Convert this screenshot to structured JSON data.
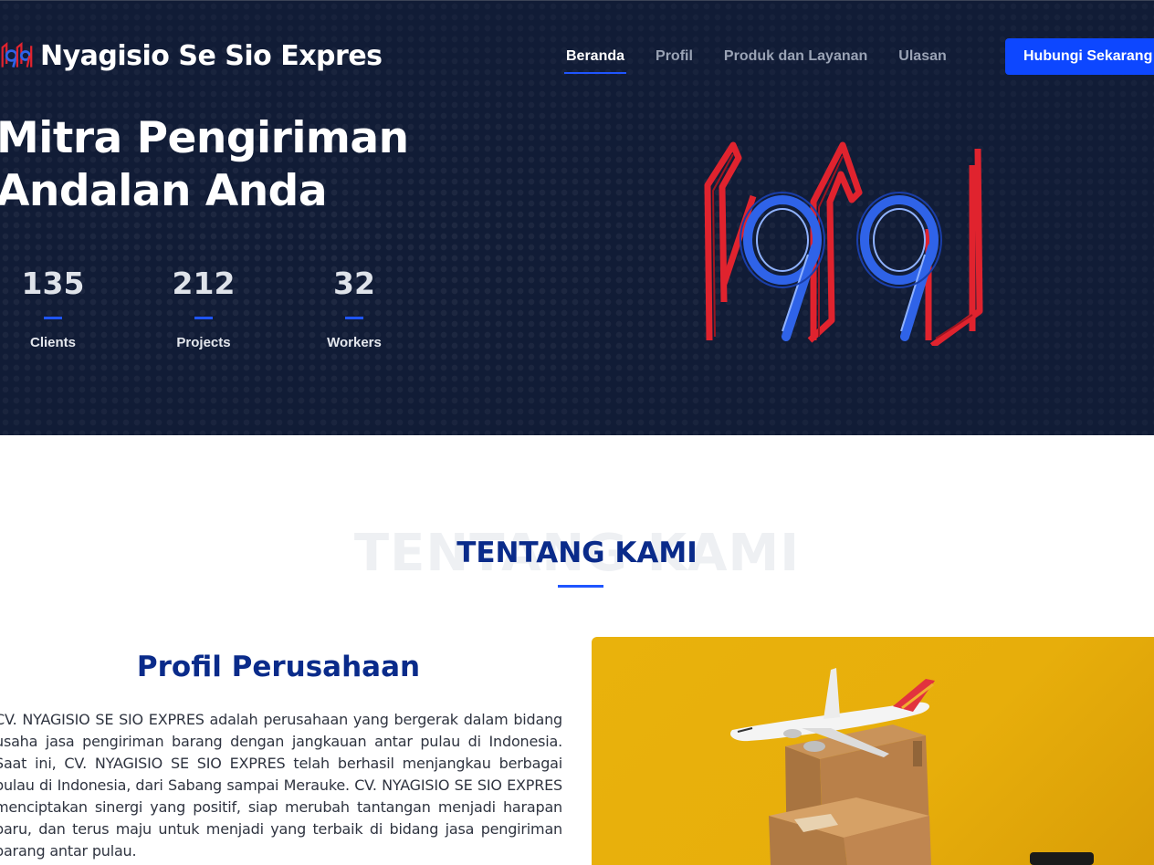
{
  "header": {
    "brand_name": "Nyagisio Se Sio Expres",
    "nav": [
      {
        "label": "Beranda",
        "active": true
      },
      {
        "label": "Profil",
        "active": false
      },
      {
        "label": "Produk dan Layanan",
        "active": false
      },
      {
        "label": "Ulasan",
        "active": false
      }
    ],
    "cta_label": "Hubungi Sekarang"
  },
  "hero": {
    "headline": "Mitra Pengiriman Andalan Anda",
    "stats": [
      {
        "value": "135",
        "label": "Clients"
      },
      {
        "value": "212",
        "label": "Projects"
      },
      {
        "value": "32",
        "label": "Workers"
      }
    ],
    "logo_text": "1919"
  },
  "about": {
    "ghost_heading": "TENTANG KAMI",
    "heading": "TENTANG KAMI",
    "profile_title": "Profil Perusahaan",
    "profile_text": "CV. NYAGISIO SE SIO EXPRES adalah perusahaan yang bergerak dalam bidang usaha jasa pengiriman barang dengan jangkauan antar pulau di Indonesia. Saat ini, CV. NYAGISIO SE SIO EXPRES telah berhasil menjangkau berbagai pulau di Indonesia, dari Sabang sampai Merauke. CV. NYAGISIO SE SIO EXPRES menciptakan sinergi yang positif, siap merubah tantangan menjadi harapan baru, dan terus maju untuk menjadi yang terbaik di bidang jasa pengiriman barang antar pulau.",
    "photo_icons": [
      "airplane-icon",
      "cardboard-box-icon"
    ]
  },
  "colors": {
    "hero_bg": "#111c36",
    "accent": "#1f55ff",
    "cta_bg": "#0d47ff",
    "heading_blue": "#0a2b8a",
    "logo_red": "#e0232e",
    "logo_blue": "#2f63e8",
    "photo_bg": "#e9b20c"
  }
}
